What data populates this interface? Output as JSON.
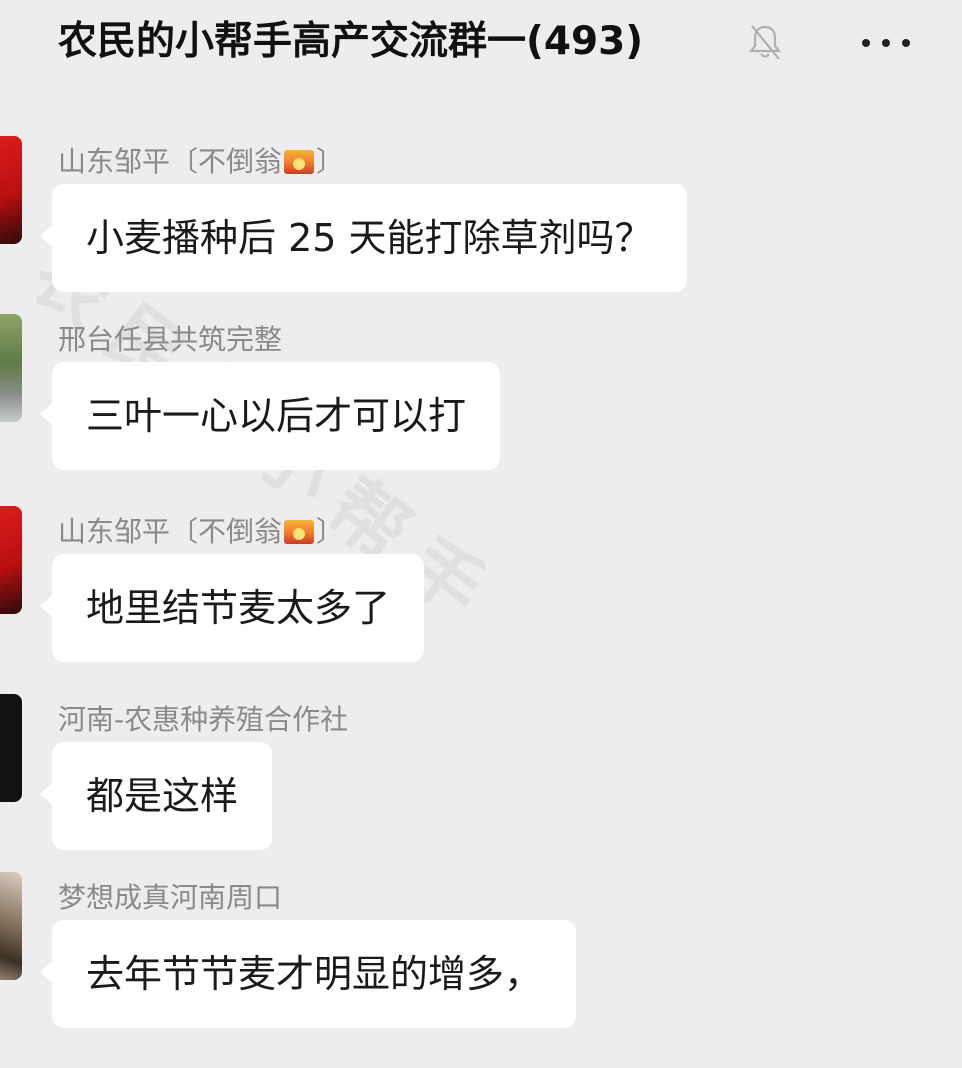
{
  "header": {
    "title": "农民的小帮手高产交流群一(493)",
    "mute_icon": "bell-slash-icon",
    "more_icon": "more-dots-icon"
  },
  "watermark": "农民的小帮手",
  "messages": [
    {
      "sender": "山东邹平〔不倒翁",
      "sender_suffix": "〕",
      "emoji": "sunset-emoji",
      "text": "小麦播种后 25 天能打除草剂吗？",
      "avatar_color": "#d91b1b"
    },
    {
      "sender": "邢台任县共筑完整",
      "text": "三叶一心以后才可以打",
      "avatar_color": "#7a8f5b"
    },
    {
      "sender": "山东邹平〔不倒翁",
      "sender_suffix": "〕",
      "emoji": "sunset-emoji",
      "text": "地里结节麦太多了",
      "avatar_color": "#d91b1b"
    },
    {
      "sender": "河南-农惠种养殖合作社",
      "text": "都是这样",
      "avatar_color": "#111111"
    },
    {
      "sender": "梦想成真河南周口",
      "text": "去年节节麦才明显的增多，",
      "avatar_color": "#6b5a48"
    }
  ]
}
